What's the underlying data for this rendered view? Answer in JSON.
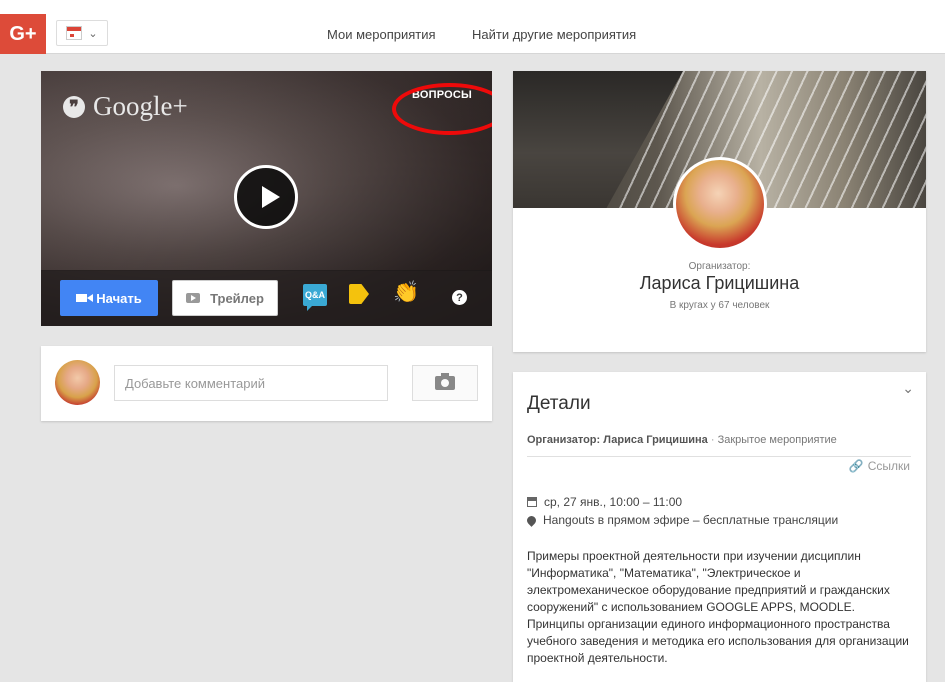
{
  "topbar": {
    "logo_text": "G+",
    "nav": {
      "my_events": "Мои мероприятия",
      "find_events": "Найти другие мероприятия"
    }
  },
  "video": {
    "brand": "Google+",
    "questions_link": "ВОПРОСЫ",
    "start_button": "Начать",
    "trailer_button": "Трейлер",
    "qa_icon_text": "Q&A",
    "help_icon_text": "?"
  },
  "comment": {
    "placeholder": "Добавьте комментарий"
  },
  "organizer": {
    "label": "Организатор:",
    "name": "Лариса Грицишина",
    "circles": "В кругах у 67 человек"
  },
  "details": {
    "title": "Детали",
    "organizer_label": "Организатор:",
    "organizer_name": "Лариса Грицишина",
    "separator": "·",
    "privacy": "Закрытое мероприятие",
    "links_label": "Ссылки",
    "date": "ср, 27 янв., 10:00 – 11:00",
    "place": "Hangouts в прямом эфире – бесплатные трансляции",
    "description": "Примеры проектной деятельности при изучении дисциплин \"Информатика\", \"Математика\", \"Электрическое и электромеханическое оборудование предприятий и гражданских сооружений\" с использованием GOOGLE APPS, MOODLE. Принципы организации единого информационного пространства учебного заведения и методика его использования для организации проектной деятельности."
  },
  "colors": {
    "brand_red": "#dd4b39",
    "start_blue": "#4285f4",
    "highlight_red": "#ee0a0a"
  }
}
